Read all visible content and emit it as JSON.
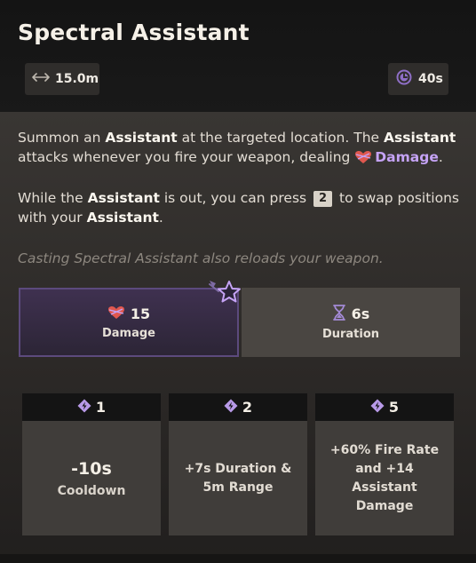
{
  "ability": {
    "title": "Spectral Assistant",
    "range": "15.0m",
    "cooldown": "40s"
  },
  "description": {
    "p1_a": "Summon an ",
    "p1_b": "Assistant",
    "p1_c": " at the targeted location. The ",
    "p1_d": "Assistant",
    "p1_e": " attacks whenever you fire your weapon, dealing ",
    "p1_damage": "Damage",
    "p1_end": ".",
    "p2_a": "While the ",
    "p2_b": "Assistant",
    "p2_c": " is out, you can press ",
    "p2_key": "2",
    "p2_d": " to swap positions with your ",
    "p2_e": "Assistant",
    "p2_end": ".",
    "p3": "Casting Spectral Assistant also reloads your weapon."
  },
  "stats": {
    "damage_value": "15",
    "damage_label": "Damage",
    "duration_value": "6s",
    "duration_label": "Duration"
  },
  "upgrades": [
    {
      "cost": "1",
      "big": "-10s",
      "sub": "Cooldown"
    },
    {
      "cost": "2",
      "text": "+7s Duration & 5m Range"
    },
    {
      "cost": "5",
      "text": "+60% Fire Rate and +14 Assistant Damage"
    }
  ],
  "colors": {
    "accent_purple": "#c5a3f5",
    "damage_red": "#e0584f",
    "upgrade_badge": "#b89ae8"
  }
}
